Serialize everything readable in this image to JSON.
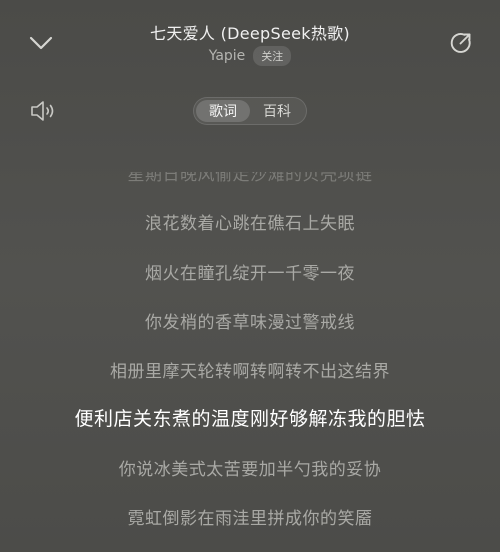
{
  "header": {
    "title": "七天爱人 (DeepSeek热歌)",
    "artist": "Yapie",
    "follow_label": "关注"
  },
  "icons": {
    "collapse": "chevron-down-icon",
    "share": "share-icon",
    "sound": "speaker-icon"
  },
  "tabs": [
    {
      "label": "歌词",
      "active": true
    },
    {
      "label": "百科",
      "active": false
    }
  ],
  "lyrics": {
    "current_index": 5,
    "lines": [
      "星期日晚风偷走沙滩的贝壳项链",
      "浪花数着心跳在礁石上失眠",
      "烟火在瞳孔绽开一千零一夜",
      "你发梢的香草味漫过警戒线",
      "相册里摩天轮转啊转啊转不出这结界",
      "便利店关东煮的温度刚好够解冻我的胆怯",
      "你说冰美式太苦要加半勺我的妥协",
      "霓虹倒影在雨洼里拼成你的笑靥"
    ]
  },
  "colors": {
    "background": "#4f4f4c",
    "text_primary": "#ffffff",
    "text_secondary": "#a9a9a5"
  }
}
